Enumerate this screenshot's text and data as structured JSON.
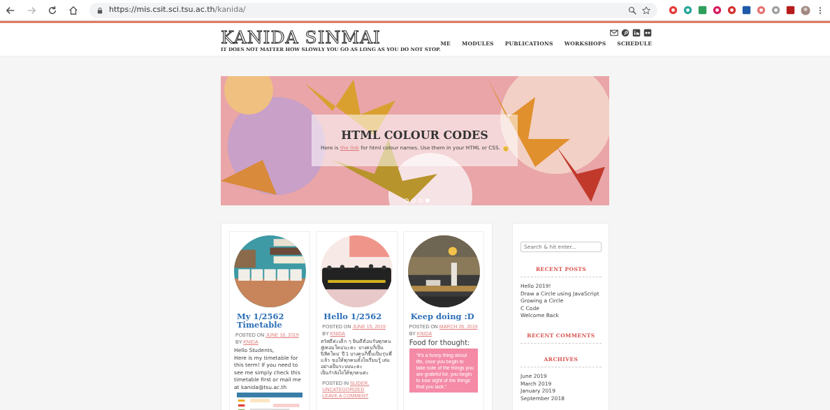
{
  "browser": {
    "url_host": "https://mis.csit.sci.tsu.ac.th",
    "url_path": "/kanida/"
  },
  "site": {
    "title": "KANIDA SINMAI",
    "tagline": "IT DOES NOT MATTER HOW SLOWLY YOU GO AS LONG AS YOU DO NOT STOP.",
    "social": [
      {
        "kind": "mail"
      },
      {
        "kind": "pin"
      },
      {
        "kind": "in"
      },
      {
        "kind": "dots"
      }
    ],
    "nav": [
      "ME",
      "MODULES",
      "PUBLICATIONS",
      "WORKSHOPS",
      "SCHEDULE"
    ]
  },
  "slider": {
    "title": "HTML COLOUR CODES",
    "text_before": "Here is ",
    "link": "the link",
    "text_after": " for html colour names. Use them in your HTML or CSS.",
    "dots": [
      {
        "selected": false
      },
      {
        "selected": false
      },
      {
        "selected": false
      },
      {
        "selected": true
      }
    ]
  },
  "posts": [
    {
      "title": "My 1/2562 Timetable",
      "meta_label": "POSTED ON",
      "date": "JUNE 16, 2019",
      "by": "BY",
      "author": "KNIDA",
      "blocks": [
        {
          "kind": "text",
          "text": "Hello Students,"
        },
        {
          "kind": "text",
          "text": "Here is my timetable for this term! If you need to see me simply check this timetable first or mail me at kanida@tsu.ac.th"
        },
        {
          "kind": "picture"
        }
      ]
    },
    {
      "title": "Hello 1/2562",
      "meta_label": "POSTED ON",
      "date": "JUNE 15, 2019",
      "by": "BY",
      "author": "KNIDA",
      "blocks": [
        {
          "kind": "text",
          "text": "สวัสดีค่ะเด็ก ๆ ยินดีต้อนรับทุกคนสู่เทอมใหม่นะคะ บางคนก็เป็นนิสิตใหม่ ปี 1 บางคนก็ขึ้นเป็นรุ่นพี่แล้ว ขอให้ทุกคนตั้งใจเรียนรู้ เล่น อย่างเป็นระบบนะคะ"
        },
        {
          "kind": "text",
          "text": "เป็นกำลังใจให้ทุกคนค่ะ"
        }
      ],
      "footer": {
        "label": "POSTED IN",
        "categories": [
          "SLIDER,",
          "UNCATEGORIZED"
        ],
        "comment": "LEAVE A COMMENT"
      }
    },
    {
      "title": "Keep doing :D",
      "meta_label": "POSTED ON",
      "date": "MARCH 26, 2019",
      "by": "BY",
      "author": "KNIDA",
      "blocks": [
        {
          "kind": "heading",
          "text": "Food for thought:"
        },
        {
          "kind": "quote",
          "text": "“It’s a funny thing about life, once you begin to take note of the things you are grateful for, you begin to lose sight of the things that you lack.”"
        }
      ]
    }
  ],
  "sidebar": {
    "search": {
      "placeholder": "Search & hit enter..."
    },
    "widgets": [
      {
        "title": "RECENT POSTS",
        "items": [
          "Hello 2019!",
          "Draw a Circle using JavaScript",
          "Growing a Circle",
          "C Code",
          "Welcome Back"
        ]
      },
      {
        "title": "RECENT COMMENTS"
      },
      {
        "title": "ARCHIVES",
        "items": [
          "June 2019",
          "March 2019",
          "January 2019",
          "September 2018"
        ]
      }
    ]
  }
}
